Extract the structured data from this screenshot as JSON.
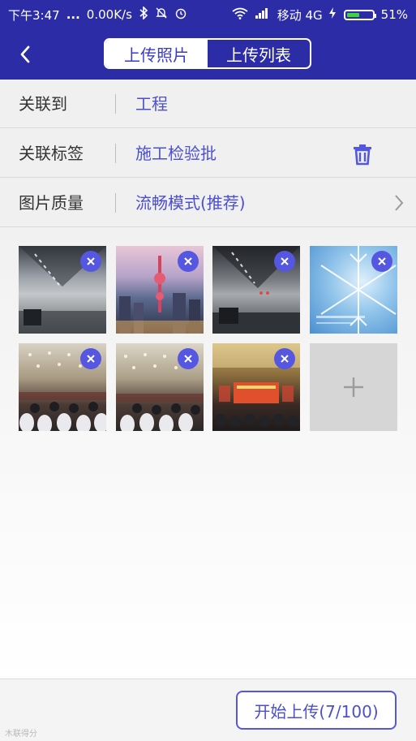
{
  "status_bar": {
    "time": "下午3:47",
    "dots": "...",
    "speed": "0.00K/s",
    "carrier": "移动 4G",
    "battery": "51%",
    "battery_level": 0.51
  },
  "header": {
    "tabs": [
      {
        "label": "上传照片",
        "active": true
      },
      {
        "label": "上传列表",
        "active": false
      }
    ]
  },
  "form": {
    "rows": [
      {
        "label": "关联到",
        "value": "工程"
      },
      {
        "label": "关联标签",
        "value": "施工检验批"
      },
      {
        "label": "图片质量",
        "value": "流畅模式(推荐)"
      }
    ]
  },
  "photos": [
    {
      "subject": "tunnel"
    },
    {
      "subject": "city-skyline"
    },
    {
      "subject": "tunnel-night"
    },
    {
      "subject": "snowflake"
    },
    {
      "subject": "conference-hall"
    },
    {
      "subject": "conference-hall"
    },
    {
      "subject": "stage"
    }
  ],
  "footer": {
    "start_label": "开始上传(7/100)",
    "watermark": "木联得分"
  },
  "colors": {
    "header": "#2c2da6",
    "accent": "#5557e0",
    "link": "#4b4fd0"
  }
}
